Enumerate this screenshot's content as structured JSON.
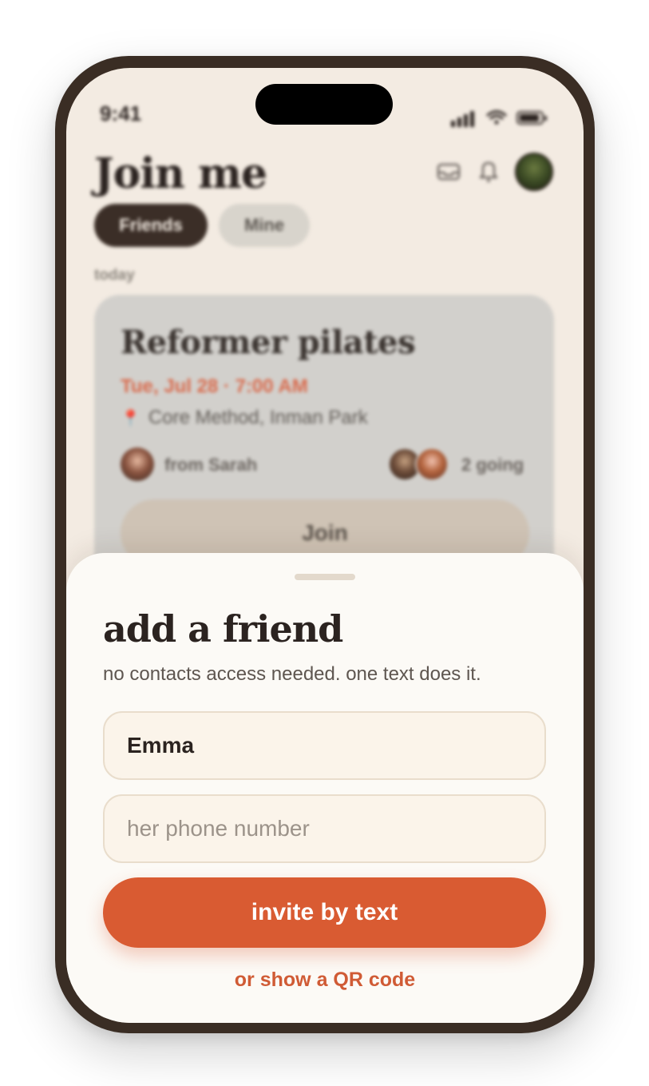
{
  "status_bar": {
    "time": "9:41"
  },
  "header": {
    "title": "Join me"
  },
  "tabs": [
    {
      "label": "Friends",
      "active": true
    },
    {
      "label": "Mine",
      "active": false
    }
  ],
  "feed": {
    "section_label": "today",
    "event": {
      "title": "Reformer pilates",
      "datetime": "Tue, Jul 28 · 7:00 AM",
      "location": "Core Method, Inman Park",
      "host_label": "from Sarah",
      "going_label": "2 going",
      "join_label": "Join"
    }
  },
  "sheet": {
    "title": "add a friend",
    "subtitle": "no contacts access needed. one text does it.",
    "name_value": "Emma",
    "phone_placeholder": "her phone number",
    "invite_label": "invite by text",
    "qr_label": "or show a QR code"
  },
  "icons": {
    "mail": "mail-icon",
    "bell": "bell-icon",
    "pin": "map-pin-icon",
    "signal": "cellular-signal-icon",
    "wifi": "wifi-icon",
    "battery": "battery-icon"
  },
  "colors": {
    "frame": "#3a2d24",
    "background": "#f3ebe2",
    "accent": "#d95b32",
    "date_red": "#d96a4c",
    "sheet": "#fcfaf6"
  }
}
